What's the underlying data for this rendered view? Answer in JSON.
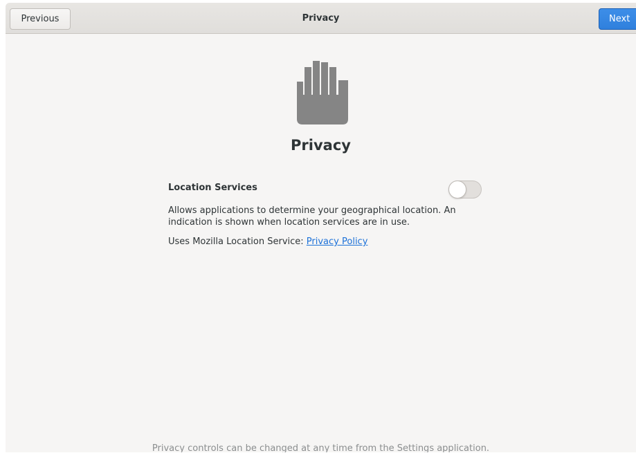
{
  "header": {
    "title": "Privacy",
    "previous_label": "Previous",
    "next_label": "Next"
  },
  "icon": "hand-icon",
  "page_title": "Privacy",
  "location": {
    "label": "Location Services",
    "enabled": false,
    "description": "Allows applications to determine your geographical location. An indication is shown when location services are in use.",
    "uses_text": "Uses Mozilla Location Service: ",
    "policy_link": "Privacy Policy"
  },
  "footer_text": "Privacy controls can be changed at any time from the Settings application.",
  "colors": {
    "accent": "#3584e4",
    "link": "#1c71d8",
    "icon": "#858585"
  }
}
